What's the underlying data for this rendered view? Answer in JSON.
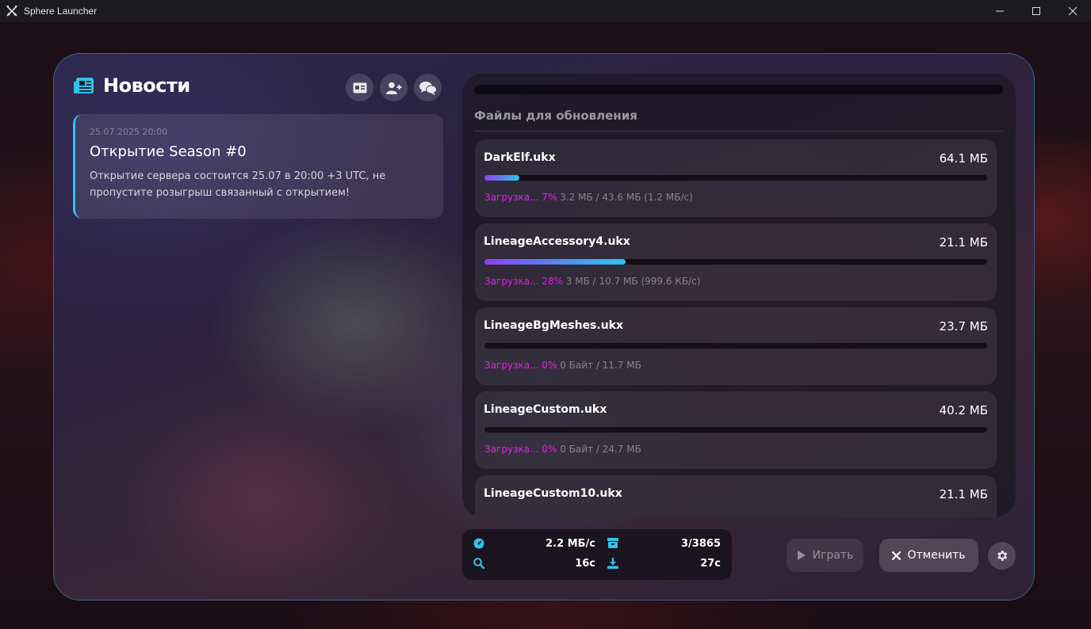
{
  "window": {
    "title": "Sphere Launcher",
    "icon": "crossed-swords-icon",
    "controls": [
      "minimize-icon",
      "maximize-icon",
      "close-icon"
    ]
  },
  "news": {
    "title": "Новости",
    "icon": "newspaper-icon",
    "actions": [
      "id-card-icon",
      "user-plus-icon",
      "chat-bubbles-icon"
    ],
    "items": [
      {
        "date": "25.07.2025 20:00",
        "title": "Открытие Season #0",
        "body": "Открытие сервера состоится 25.07 в 20:00 +3 UTC, не пропустите розыгрыш связанный с открытием!"
      }
    ]
  },
  "files": {
    "heading": "Файлы для обновления",
    "items": [
      {
        "name": "DarkElf.ukx",
        "size": "64.1 МБ",
        "progress": 0.07,
        "status": "Загрузка... 7%",
        "detail": "3.2 МБ / 43.6 МБ (1.2 МБ/с)"
      },
      {
        "name": "LineageAccessory4.ukx",
        "size": "21.1 МБ",
        "progress": 0.28,
        "status": "Загрузка... 28%",
        "detail": "3 МБ / 10.7 МБ (999.6 КБ/с)"
      },
      {
        "name": "LineageBgMeshes.ukx",
        "size": "23.7 МБ",
        "progress": 0,
        "status": "Загрузка... 0%",
        "detail": "0 Байт / 11.7 МБ"
      },
      {
        "name": "LineageCustom.ukx",
        "size": "40.2 МБ",
        "progress": 0,
        "status": "Загрузка... 0%",
        "detail": "0 Байт / 24.7 МБ"
      },
      {
        "name": "LineageCustom10.ukx",
        "size": "21.1 МБ",
        "progress": 0,
        "status": "",
        "detail": ""
      }
    ]
  },
  "stats": {
    "speed": {
      "icon": "gauge-icon",
      "value": "2.2 МБ/с"
    },
    "files": {
      "icon": "archive-icon",
      "value": "3/3865"
    },
    "check_time": {
      "icon": "search-icon",
      "value": "16с"
    },
    "download_time": {
      "icon": "download-icon",
      "value": "27с"
    }
  },
  "actions": {
    "play_label": "Играть",
    "cancel_label": "Отменить",
    "settings_icon": "gear-icon"
  },
  "colors": {
    "accent": "#2ec4e8",
    "status": "#e61ee6",
    "progress_start": "#8a3ff0",
    "progress_end": "#2ec4f0"
  }
}
